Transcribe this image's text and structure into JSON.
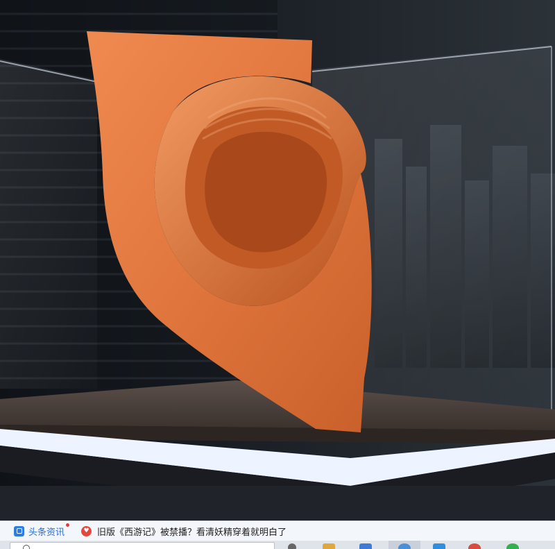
{
  "news_bar": {
    "source_label": "头条资讯",
    "headline": "旧版《西游记》被禁播？看清妖精穿着就明白了",
    "icons": {
      "source": "news-app-icon",
      "heart": "heart-icon"
    }
  },
  "taskbar": {
    "icons": [
      "search-icon",
      "file-explorer-icon",
      "browser-icon",
      "mail-icon",
      "media-icon",
      "chat-icon"
    ]
  },
  "colors": {
    "fabric": "#e07a42",
    "fabric_shadow": "#b85527",
    "backdrop": "#15181d",
    "platform_wood": "#4a3f3a",
    "platform_light": "#e8f0ff",
    "news_link": "#2f6fd6"
  }
}
